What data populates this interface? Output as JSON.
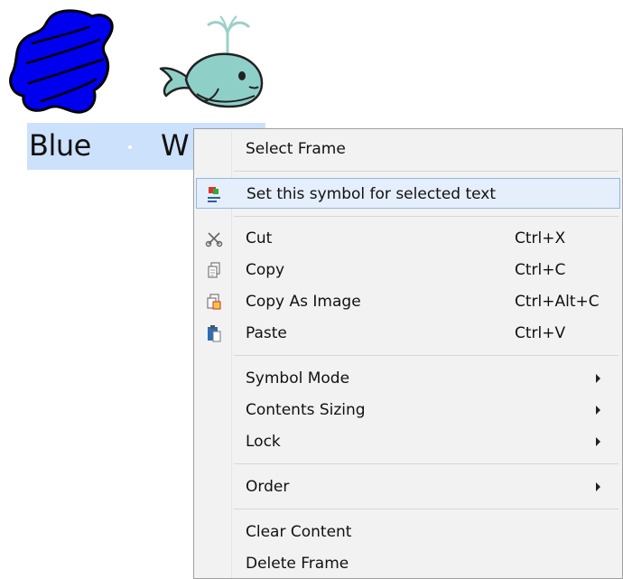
{
  "document": {
    "words": [
      "Blue",
      "W"
    ],
    "symbols": [
      {
        "name": "blue-scribble",
        "color": "#0000ee"
      },
      {
        "name": "whale",
        "color": "#8ed0c8"
      }
    ],
    "selection_color": "#cce1fb"
  },
  "context_menu": {
    "items": [
      {
        "label": "Select Frame",
        "shortcut": "",
        "submenu": false
      },
      {
        "label": "Set this symbol for selected text",
        "shortcut": "",
        "submenu": false,
        "icon": "symbol-text-icon",
        "highlighted": true
      },
      {
        "label": "Cut",
        "shortcut": "Ctrl+X",
        "submenu": false,
        "icon": "scissors-icon"
      },
      {
        "label": "Copy",
        "shortcut": "Ctrl+C",
        "submenu": false,
        "icon": "copy-icon"
      },
      {
        "label": "Copy As Image",
        "shortcut": "Ctrl+Alt+C",
        "submenu": false,
        "icon": "copy-image-icon"
      },
      {
        "label": "Paste",
        "shortcut": "Ctrl+V",
        "submenu": false,
        "icon": "paste-icon"
      },
      {
        "label": "Symbol Mode",
        "shortcut": "",
        "submenu": true
      },
      {
        "label": "Contents Sizing",
        "shortcut": "",
        "submenu": true
      },
      {
        "label": "Lock",
        "shortcut": "",
        "submenu": true
      },
      {
        "label": "Order",
        "shortcut": "",
        "submenu": true
      },
      {
        "label": "Clear Content",
        "shortcut": "",
        "submenu": false
      },
      {
        "label": "Delete Frame",
        "shortcut": "",
        "submenu": false
      }
    ],
    "highlight_color": "#e5eefb",
    "background_color": "#f2f2f2"
  }
}
